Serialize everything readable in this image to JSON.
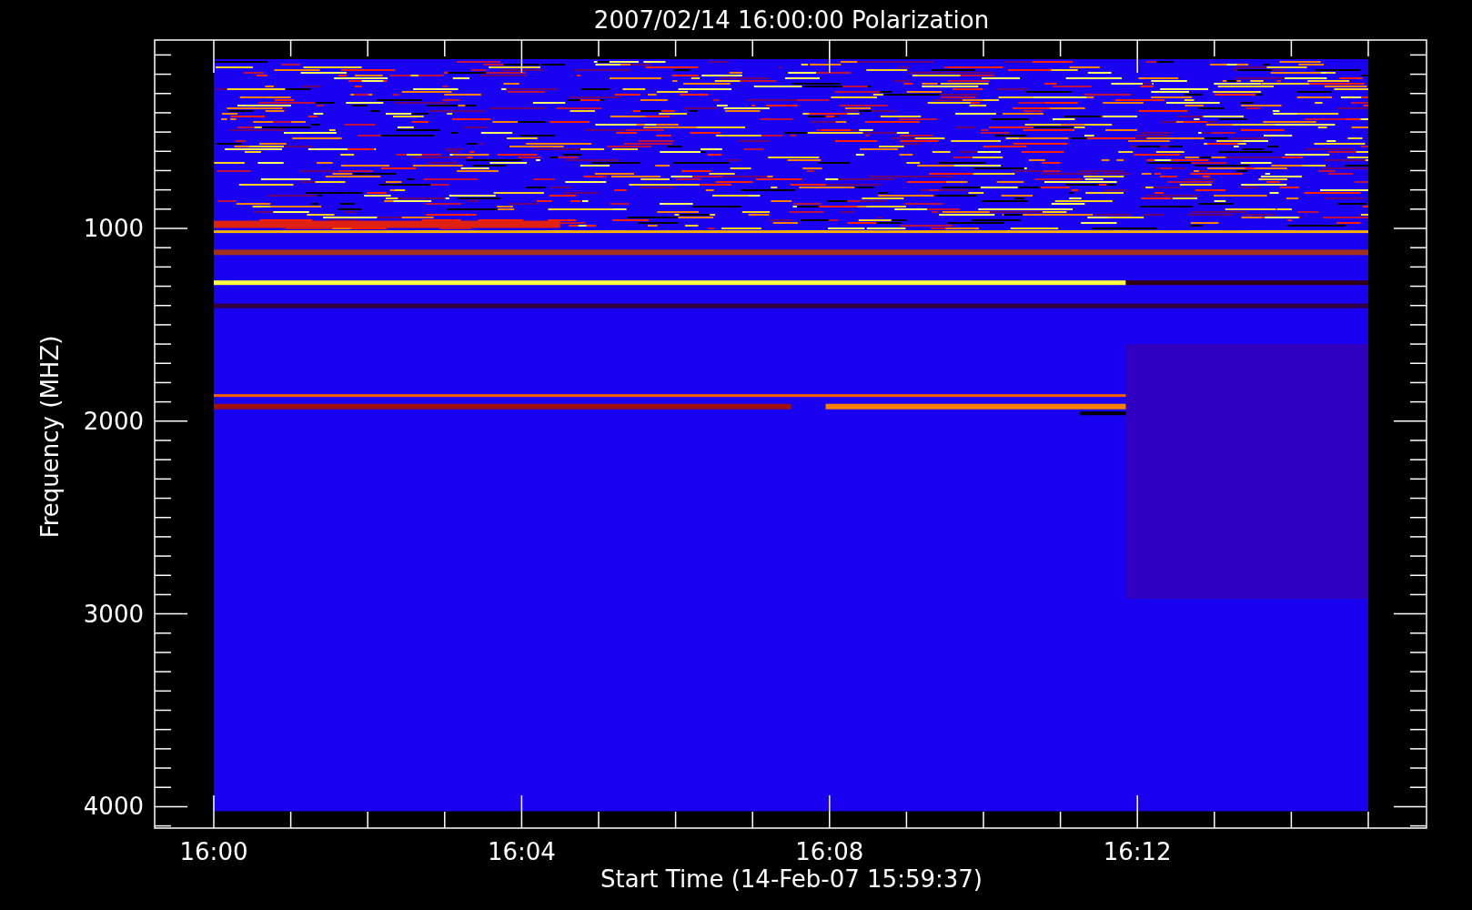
{
  "title": "2007/02/14 16:00:00 Polarization",
  "x_axis": {
    "label": "Start Time (14-Feb-07 15:59:37)",
    "ticks": [
      "16:00",
      "16:04",
      "16:08",
      "16:12"
    ]
  },
  "y_axis": {
    "label": "Frequency (MHZ)",
    "ticks": [
      "1000",
      "2000",
      "3000",
      "4000"
    ]
  }
}
